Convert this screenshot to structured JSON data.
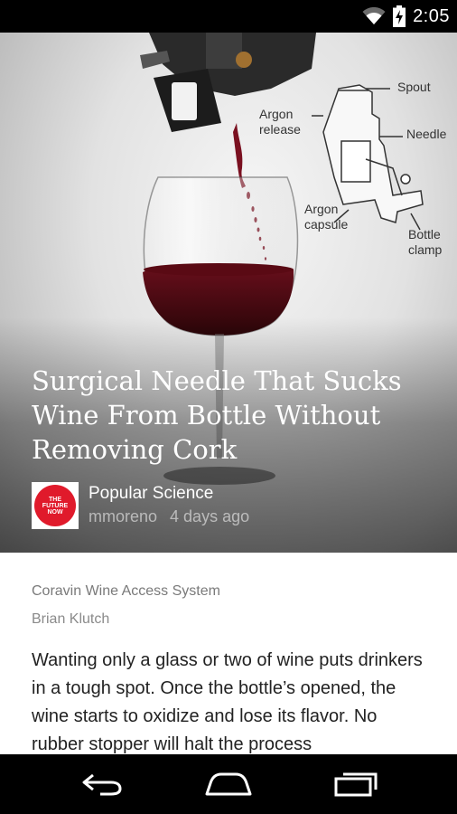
{
  "status_bar": {
    "time": "2:05",
    "icons": [
      "wifi-icon",
      "battery-charging-icon"
    ]
  },
  "hero": {
    "title": "Surgical Needle That Sucks Wine From Bottle Without Removing Cork",
    "diagram_labels": {
      "spout": "Spout",
      "argon_release": "Argon\nrelease",
      "needle": "Needle",
      "argon_capsule": "Argon\ncapsule",
      "bottle_clamp": "Bottle\nclamp"
    },
    "source": {
      "logo_text": [
        "THE",
        "FUTURE",
        "NOW"
      ],
      "name": "Popular Science",
      "author": "mmoreno",
      "time_ago": "4 days ago"
    }
  },
  "article": {
    "caption": "Coravin Wine Access System",
    "credit": "Brian Klutch",
    "body": "Wanting only a glass or two of wine puts drinkers in a tough spot. Once the bottle’s opened, the wine starts to oxidize and lose its flavor. No rubber stopper will halt the process"
  },
  "nav": {
    "icons": [
      "back-icon",
      "home-icon",
      "recent-apps-icon"
    ]
  },
  "colors": {
    "status_bar": "#000000",
    "nav_bar": "#000000",
    "logo_red": "#e01a2b",
    "wine": "#4a0a12"
  }
}
